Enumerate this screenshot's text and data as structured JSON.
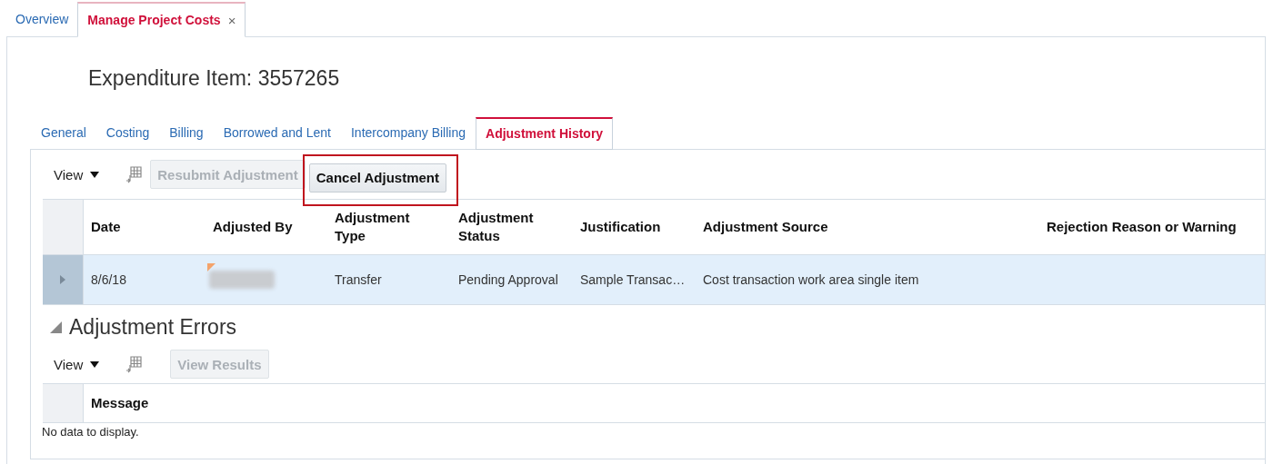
{
  "page_tabs": [
    {
      "label": "Overview",
      "selected": false,
      "closable": false
    },
    {
      "label": "Manage Project Costs",
      "selected": true,
      "closable": true,
      "close_glyph": "×"
    }
  ],
  "title": "Expenditure Item: 3557265",
  "sub_tabs": [
    {
      "label": "General",
      "selected": false
    },
    {
      "label": "Costing",
      "selected": false
    },
    {
      "label": "Billing",
      "selected": false
    },
    {
      "label": "Borrowed and Lent",
      "selected": false
    },
    {
      "label": "Intercompany Billing",
      "selected": false
    },
    {
      "label": "Adjustment History",
      "selected": true
    }
  ],
  "history": {
    "view_menu": "View",
    "buttons": [
      {
        "label": "Resubmit Adjustment",
        "disabled": true,
        "highlighted": false
      },
      {
        "label": "Cancel Adjustment",
        "disabled": false,
        "highlighted": true
      }
    ],
    "columns": [
      "Date",
      "Adjusted By",
      "Adjustment Type",
      "Adjustment Status",
      "Justification",
      "Adjustment Source",
      "Rejection Reason or Warning"
    ],
    "rows": [
      {
        "selected": true,
        "expanded": false,
        "date": "8/6/18",
        "adjusted_by_redacted": true,
        "adjusted_by_flagged": true,
        "type": "Transfer",
        "status": "Pending Approval",
        "justification": "Sample Transac…",
        "source": "Cost transaction work area single item"
      }
    ]
  },
  "errors": {
    "title": "Adjustment Errors",
    "expanded": true,
    "view_menu": "View",
    "buttons": [
      {
        "label": "View Results",
        "disabled": true
      }
    ],
    "columns": [
      "Message"
    ],
    "empty_text": "No data to display."
  }
}
